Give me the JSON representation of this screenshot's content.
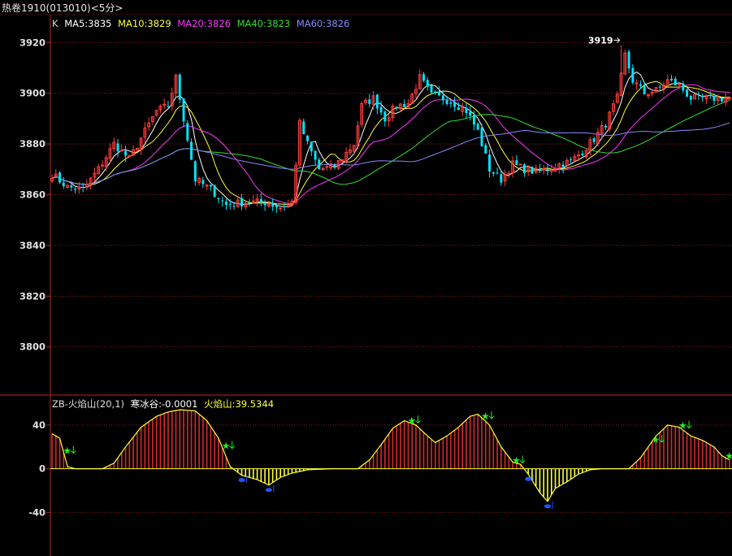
{
  "title": "热卷1910(013010)<5分>",
  "legend_main": {
    "k_label": "K",
    "items": [
      {
        "text": "MA5:3835",
        "color": "#ffffff"
      },
      {
        "text": "MA10:3829",
        "color": "#ffff33"
      },
      {
        "text": "MA20:3826",
        "color": "#ff33ff"
      },
      {
        "text": "MA40:3823",
        "color": "#33dd33"
      },
      {
        "text": "MA60:3826",
        "color": "#8888ff"
      }
    ]
  },
  "legend_indicator": {
    "name": "ZB-火焰山(20,1)",
    "name_color": "#dddddd",
    "items": [
      {
        "text": "寒冰谷:-0.0001",
        "color": "#ffffff"
      },
      {
        "text": "火焰山:39.5344",
        "color": "#ffff33"
      }
    ]
  },
  "chart_data": [
    {
      "type": "candlestick",
      "y_ticks": [
        "3920",
        "3900",
        "3880",
        "3860",
        "3840",
        "3820",
        "3800"
      ],
      "ylim": [
        3781,
        3931
      ],
      "highlight": {
        "label": "3919",
        "value": 3919
      },
      "colors": {
        "up": "#ff3c3c",
        "down": "#00e5ff",
        "grid": "#8a1a1a",
        "axis": "#b02828"
      },
      "ma_series": [
        {
          "name": "MA5",
          "color": "#ffffff"
        },
        {
          "name": "MA10",
          "color": "#ffff33"
        },
        {
          "name": "MA20",
          "color": "#ff33ff"
        },
        {
          "name": "MA40",
          "color": "#33dd33"
        },
        {
          "name": "MA60",
          "color": "#8888ff"
        }
      ],
      "close_anchors": [
        [
          0,
          3868
        ],
        [
          4,
          3863
        ],
        [
          8,
          3862
        ],
        [
          12,
          3870
        ],
        [
          16,
          3880
        ],
        [
          20,
          3874
        ],
        [
          24,
          3885
        ],
        [
          27,
          3893
        ],
        [
          30,
          3895
        ],
        [
          32,
          3906
        ],
        [
          34,
          3890
        ],
        [
          37,
          3866
        ],
        [
          41,
          3862
        ],
        [
          45,
          3856
        ],
        [
          50,
          3857
        ],
        [
          55,
          3857
        ],
        [
          59,
          3855
        ],
        [
          62,
          3857
        ],
        [
          64,
          3888
        ],
        [
          66,
          3880
        ],
        [
          69,
          3870
        ],
        [
          73,
          3871
        ],
        [
          78,
          3880
        ],
        [
          80,
          3895
        ],
        [
          83,
          3898
        ],
        [
          86,
          3890
        ],
        [
          89,
          3895
        ],
        [
          92,
          3896
        ],
        [
          95,
          3906
        ],
        [
          98,
          3899
        ],
        [
          101,
          3898
        ],
        [
          104,
          3896
        ],
        [
          107,
          3893
        ],
        [
          110,
          3885
        ],
        [
          113,
          3870
        ],
        [
          116,
          3866
        ],
        [
          119,
          3872
        ],
        [
          122,
          3870
        ],
        [
          125,
          3869
        ],
        [
          128,
          3870
        ],
        [
          131,
          3872
        ],
        [
          134,
          3873
        ],
        [
          137,
          3877
        ],
        [
          140,
          3882
        ],
        [
          143,
          3888
        ],
        [
          146,
          3898
        ],
        [
          148,
          3915
        ],
        [
          150,
          3905
        ],
        [
          153,
          3900
        ],
        [
          156,
          3901
        ],
        [
          159,
          3905
        ],
        [
          162,
          3903
        ],
        [
          165,
          3898
        ]
      ]
    },
    {
      "type": "area",
      "y_ticks": [
        "40",
        "0",
        "-40"
      ],
      "ylim": [
        -80,
        66
      ],
      "series": [
        {
          "name": "火焰山",
          "color": "#ffff33"
        },
        {
          "name": "寒冰谷",
          "color": "#ffffff"
        }
      ],
      "colors": {
        "positive_bar": "#ff3030",
        "negative_bar": "#ffff40",
        "line": "#ffff33",
        "star": "#22ee22",
        "down_marker": "#2255ff"
      },
      "anchors": [
        [
          0,
          32
        ],
        [
          2,
          28
        ],
        [
          4,
          2
        ],
        [
          6,
          0
        ],
        [
          13,
          0
        ],
        [
          16,
          5
        ],
        [
          19,
          20
        ],
        [
          23,
          38
        ],
        [
          27,
          48
        ],
        [
          30,
          52
        ],
        [
          33,
          54
        ],
        [
          37,
          53
        ],
        [
          40,
          44
        ],
        [
          43,
          28
        ],
        [
          46,
          2
        ],
        [
          49,
          -6
        ],
        [
          53,
          -10
        ],
        [
          56,
          -15
        ],
        [
          59,
          -8
        ],
        [
          62,
          -4
        ],
        [
          66,
          -1
        ],
        [
          69,
          -0.5
        ],
        [
          73,
          0
        ],
        [
          79,
          0
        ],
        [
          82,
          8
        ],
        [
          85,
          22
        ],
        [
          88,
          37
        ],
        [
          91,
          44
        ],
        [
          94,
          40
        ],
        [
          97,
          30
        ],
        [
          99,
          24
        ],
        [
          102,
          30
        ],
        [
          105,
          38
        ],
        [
          108,
          48
        ],
        [
          110,
          50
        ],
        [
          113,
          40
        ],
        [
          116,
          20
        ],
        [
          119,
          6
        ],
        [
          121,
          4
        ],
        [
          123,
          -5
        ],
        [
          126,
          -22
        ],
        [
          128,
          -30
        ],
        [
          130,
          -18
        ],
        [
          133,
          -12
        ],
        [
          136,
          -5
        ],
        [
          139,
          -1
        ],
        [
          142,
          0
        ],
        [
          149,
          0
        ],
        [
          152,
          10
        ],
        [
          156,
          30
        ],
        [
          159,
          40
        ],
        [
          162,
          38
        ],
        [
          165,
          30
        ],
        [
          168,
          26
        ],
        [
          171,
          20
        ],
        [
          173,
          12
        ],
        [
          175,
          8
        ]
      ],
      "stars": [
        3,
        44,
        92,
        111,
        119,
        155,
        162,
        174
      ],
      "down_markers": [
        49,
        56,
        123,
        128
      ]
    }
  ]
}
